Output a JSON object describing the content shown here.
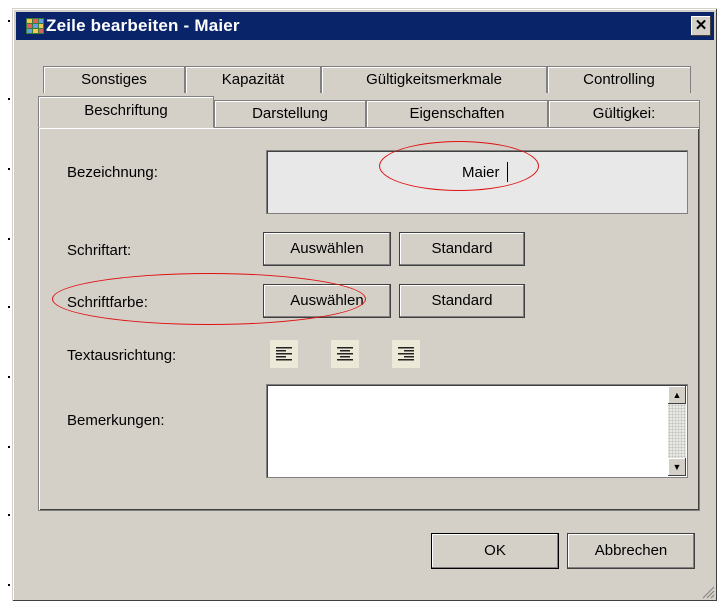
{
  "window": {
    "title": "Zeile bearbeiten - Maier",
    "close_symbol": "✕"
  },
  "tabs": {
    "row_back": [
      {
        "label": "Sonstiges"
      },
      {
        "label": "Kapazität"
      },
      {
        "label": "Gültigkeitsmerkmale"
      },
      {
        "label": "Controlling"
      }
    ],
    "row_front": [
      {
        "label": "Beschriftung",
        "active": true
      },
      {
        "label": "Darstellung"
      },
      {
        "label": "Eigenschaften"
      },
      {
        "label": "Gültigkei:"
      }
    ]
  },
  "form": {
    "bezeichnung_label": "Bezeichnung:",
    "bezeichnung_value": "Maier",
    "schriftart_label": "Schriftart:",
    "schriftfarbe_label": "Schriftfarbe:",
    "select_label": "Auswählen",
    "standard_label": "Standard",
    "textausrichtung_label": "Textausrichtung:",
    "bemerkungen_label": "Bemerkungen:",
    "bemerkungen_value": ""
  },
  "footer": {
    "ok_label": "OK",
    "cancel_label": "Abbrechen"
  },
  "icons": {
    "app": "table-grid-icon",
    "align_left": "align-left-icon",
    "align_center": "align-center-icon",
    "align_right": "align-right-icon"
  },
  "colors": {
    "titlebar": "#0a246a",
    "dialog_bg": "#d4d0c8",
    "highlight": "#e01010"
  }
}
